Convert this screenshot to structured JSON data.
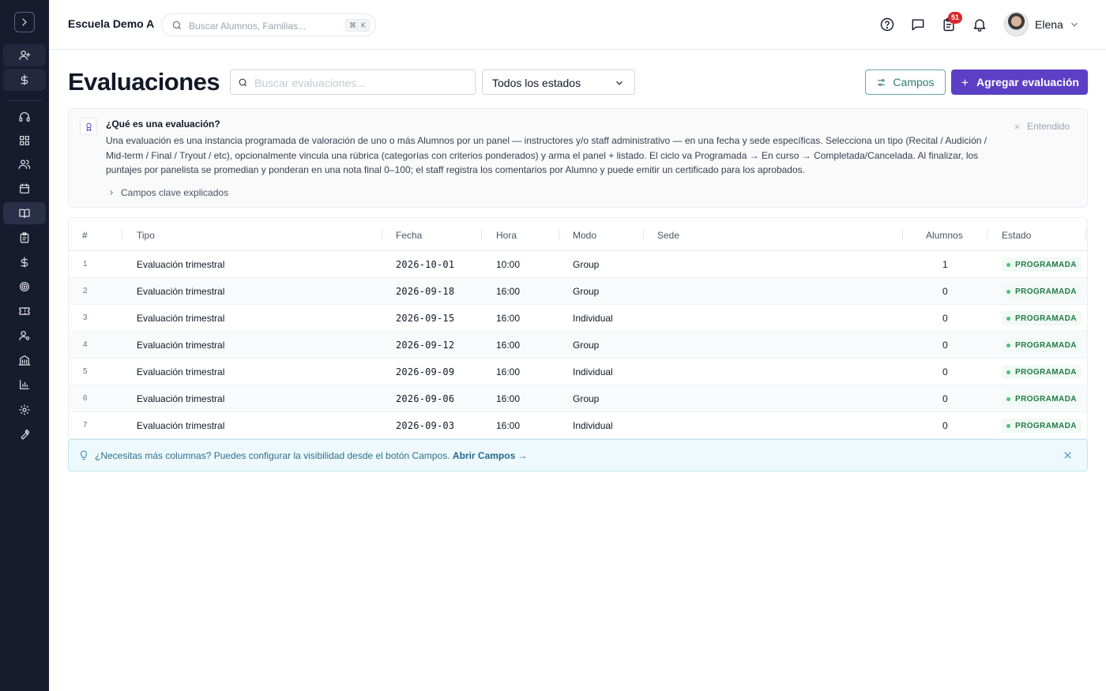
{
  "header": {
    "school_name": "Escuela Demo A",
    "search_placeholder": "Buscar Alumnos, Familias...",
    "shortcut_key1": "⌘",
    "shortcut_key2": "K",
    "notifications_count": "51",
    "user_name": "Elena",
    "icons": [
      "help-icon",
      "chat-icon",
      "clipboard-icon",
      "bell-icon"
    ]
  },
  "sidebar": {
    "icons": [
      "add-user-icon",
      "dollar-icon",
      "headset-icon",
      "grid-icon",
      "users-icon",
      "calendar-icon",
      "book-icon",
      "clipboard-icon",
      "dollar-icon",
      "target-icon",
      "ticket-icon",
      "user-settings-icon",
      "building-icon",
      "chart-icon",
      "gear-icon",
      "wrench-icon"
    ],
    "active": "book-icon"
  },
  "page": {
    "title": "Evaluaciones",
    "search_placeholder": "Buscar evaluaciones...",
    "status_filter": "Todos los estados",
    "fields_button": "Campos",
    "add_button": "Agregar evaluación"
  },
  "info": {
    "title": "¿Qué es una evaluación?",
    "body": "Una evaluación es una instancia programada de valoración de uno o más Alumnos por un panel — instructores y/o staff administrativo — en una fecha y sede específicas. Selecciona un tipo (Recital / Audición / Mid-term / Final / Tryout / etc), opcionalmente vincula una rúbrica (categorías con criterios ponderados) y arma el panel + listado. El ciclo va Programada → En curso → Completada/Cancelada. Al finalizar, los puntajes por panelista se promedian y ponderan en una nota final 0–100; el staff registra los comentarios por Alumno y puede emitir un certificado para los aprobados.",
    "expand_label": "Campos clave explicados",
    "dismiss_label": "Entendido"
  },
  "table": {
    "columns": [
      "#",
      "Tipo",
      "Fecha",
      "Hora",
      "Modo",
      "Sede",
      "Alumnos",
      "Estado"
    ],
    "rows": [
      {
        "n": "1",
        "tipo": "Evaluación trimestral",
        "fecha": "2026-10-01",
        "hora": "10:00",
        "modo": "Group",
        "sede": "",
        "alumnos": "1",
        "estado": "PROGRAMADA"
      },
      {
        "n": "2",
        "tipo": "Evaluación trimestral",
        "fecha": "2026-09-18",
        "hora": "16:00",
        "modo": "Group",
        "sede": "",
        "alumnos": "0",
        "estado": "PROGRAMADA"
      },
      {
        "n": "3",
        "tipo": "Evaluación trimestral",
        "fecha": "2026-09-15",
        "hora": "16:00",
        "modo": "Individual",
        "sede": "",
        "alumnos": "0",
        "estado": "PROGRAMADA"
      },
      {
        "n": "4",
        "tipo": "Evaluación trimestral",
        "fecha": "2026-09-12",
        "hora": "16:00",
        "modo": "Group",
        "sede": "",
        "alumnos": "0",
        "estado": "PROGRAMADA"
      },
      {
        "n": "5",
        "tipo": "Evaluación trimestral",
        "fecha": "2026-09-09",
        "hora": "16:00",
        "modo": "Individual",
        "sede": "",
        "alumnos": "0",
        "estado": "PROGRAMADA"
      },
      {
        "n": "6",
        "tipo": "Evaluación trimestral",
        "fecha": "2026-09-06",
        "hora": "16:00",
        "modo": "Group",
        "sede": "",
        "alumnos": "0",
        "estado": "PROGRAMADA"
      },
      {
        "n": "7",
        "tipo": "Evaluación trimestral",
        "fecha": "2026-09-03",
        "hora": "16:00",
        "modo": "Individual",
        "sede": "",
        "alumnos": "0",
        "estado": "PROGRAMADA"
      }
    ]
  },
  "tip": {
    "text": "¿Necesitas más columnas? Puedes configurar la visibilidad desde el botón Campos. ",
    "link": "Abrir Campos →"
  },
  "colors": {
    "sidebar_bg": "#171b2e",
    "primary": "#5b3fc4",
    "teal": "#2f7f74",
    "status_green": "#237a4a",
    "badge_red": "#dc2626"
  }
}
